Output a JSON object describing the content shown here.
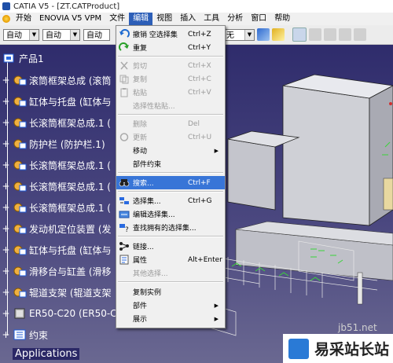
{
  "window": {
    "title": "CATIA V5 - [ZT.CATProduct]"
  },
  "menubar": {
    "items": [
      {
        "label": "开始",
        "active": false
      },
      {
        "label": "ENOVIA V5 VPM",
        "active": false
      },
      {
        "label": "文件",
        "active": false
      },
      {
        "label": "编辑",
        "active": true
      },
      {
        "label": "视图",
        "active": false
      },
      {
        "label": "插入",
        "active": false
      },
      {
        "label": "工具",
        "active": false
      },
      {
        "label": "分析",
        "active": false
      },
      {
        "label": "窗口",
        "active": false
      },
      {
        "label": "帮助",
        "active": false
      }
    ]
  },
  "toolbar": {
    "combo1": "自动",
    "combo2": "自动",
    "combo3": "自动",
    "combo4": "无"
  },
  "tree": {
    "root": "产品1",
    "nodes": [
      "滚筒框架总成 (滚筒",
      "缸体与托盘 (缸体与",
      "长滚筒框架总成.1 (",
      "防护栏 (防护栏.1)",
      "长滚筒框架总成.1 (",
      "长滚筒框架总成.1 (",
      "长滚筒框架总成.1 (",
      "发动机定位装置 (发",
      "缸体与托盘 (缸体与",
      "滑移台与缸盖 (滑移",
      "辊道支架 (辊道支架",
      "ER50-C20 (ER50-C"
    ],
    "constraints": "约束",
    "applications": "Applications"
  },
  "edit_menu": {
    "items": [
      {
        "icon": "undo-icon",
        "label": "撤销 空选择集",
        "shortcut": "Ctrl+Z",
        "disabled": false
      },
      {
        "icon": "redo-icon",
        "label": "重复",
        "shortcut": "Ctrl+Y",
        "disabled": false
      },
      {
        "icon": "cut-icon",
        "label": "剪切",
        "shortcut": "Ctrl+X",
        "disabled": true
      },
      {
        "icon": "copy-icon",
        "label": "复制",
        "shortcut": "Ctrl+C",
        "disabled": true
      },
      {
        "icon": "paste-icon",
        "label": "粘贴",
        "shortcut": "Ctrl+V",
        "disabled": true
      },
      {
        "icon": "",
        "label": "选择性粘贴...",
        "shortcut": "",
        "disabled": true
      },
      {
        "icon": "",
        "label": "删除",
        "shortcut": "Del",
        "disabled": true
      },
      {
        "icon": "refresh-icon",
        "label": "更新",
        "shortcut": "Ctrl+U",
        "disabled": true
      },
      {
        "icon": "",
        "label": "移动",
        "shortcut": "",
        "disabled": false,
        "submenu": true
      },
      {
        "icon": "",
        "label": "部件约束",
        "shortcut": "",
        "disabled": false
      },
      {
        "icon": "binoculars-icon",
        "label": "搜索...",
        "shortcut": "Ctrl+F",
        "disabled": false,
        "highlight": true
      },
      {
        "icon": "selection-set-icon",
        "label": "选择集...",
        "shortcut": "Ctrl+G",
        "disabled": false
      },
      {
        "icon": "edit-selection-icon",
        "label": "编辑选择集...",
        "shortcut": "",
        "disabled": false
      },
      {
        "icon": "find-owning-icon",
        "label": "查找拥有的选择集...",
        "shortcut": "",
        "disabled": false
      },
      {
        "icon": "links-icon",
        "label": "链接...",
        "shortcut": "",
        "disabled": false
      },
      {
        "icon": "properties-icon",
        "label": "属性",
        "shortcut": "Alt+Enter",
        "disabled": false
      },
      {
        "icon": "",
        "label": "其他选择...",
        "shortcut": "",
        "disabled": true
      },
      {
        "icon": "",
        "label": "复制实例",
        "shortcut": "",
        "disabled": false
      },
      {
        "icon": "",
        "label": "部件",
        "shortcut": "",
        "disabled": false,
        "submenu": true
      },
      {
        "icon": "",
        "label": "展示",
        "shortcut": "",
        "disabled": false,
        "submenu": true
      }
    ]
  },
  "watermark": {
    "text": "易采站长站",
    "domain": "jb51.net"
  }
}
